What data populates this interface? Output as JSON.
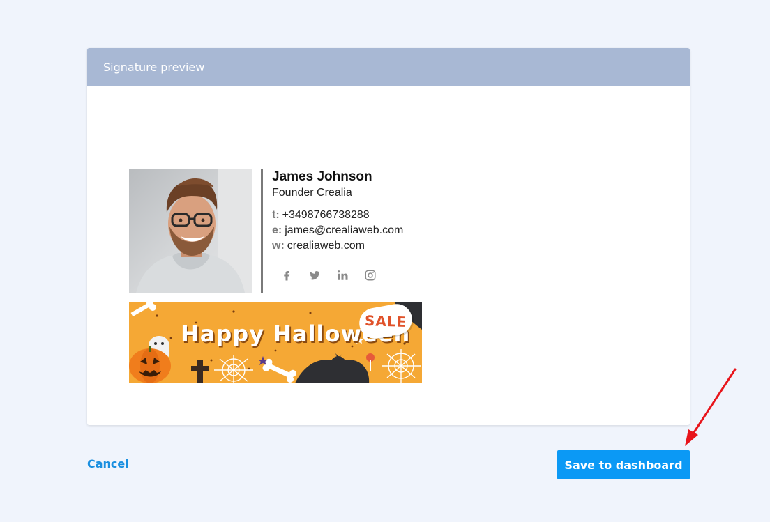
{
  "card": {
    "title": "Signature preview"
  },
  "signature": {
    "name": "James Johnson",
    "role": "Founder Crealia",
    "contacts": [
      {
        "label": "t:",
        "value": "+3498766738288"
      },
      {
        "label": "e:",
        "value": "james@crealiaweb.com"
      },
      {
        "label": "w:",
        "value": "crealiaweb.com"
      }
    ],
    "social_icons": [
      "facebook-icon",
      "twitter-icon",
      "linkedin-icon",
      "instagram-icon"
    ],
    "icon_color": "#8a8a8a",
    "divider_color": "#7a7a7a"
  },
  "banner": {
    "title": "Happy Halloween",
    "badge": "SALE",
    "background": "#f5a835"
  },
  "footer": {
    "cancel_label": "Cancel",
    "save_label": "Save to dashboard"
  },
  "colors": {
    "header_bg": "#a8b8d4",
    "primary": "#0b99f5",
    "link": "#1a8fe0",
    "annotation_arrow": "#e8141b"
  }
}
